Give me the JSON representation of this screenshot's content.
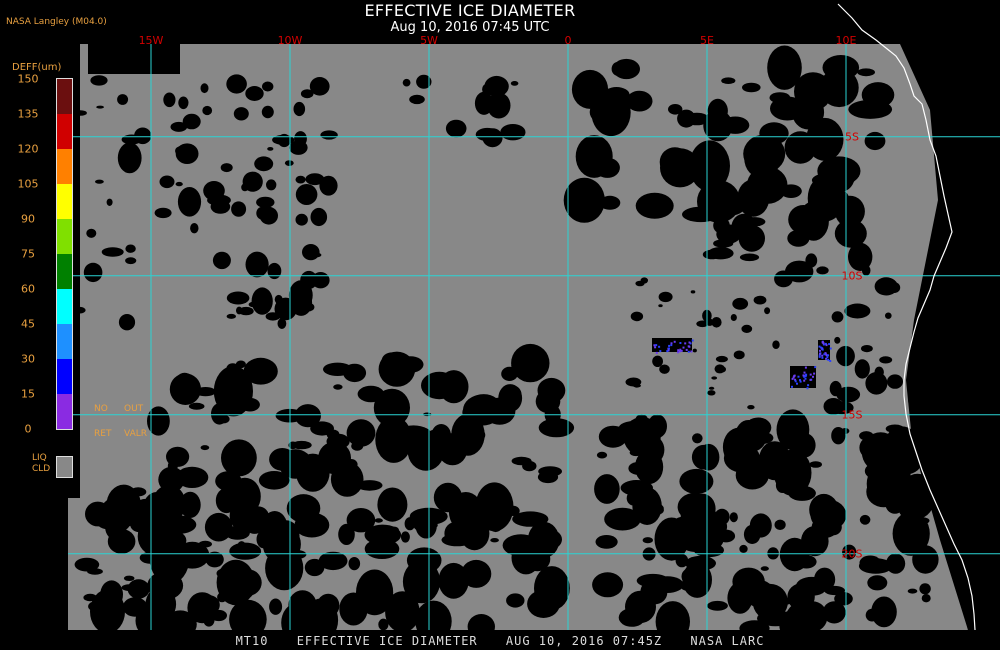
{
  "header": {
    "title": "EFFECTIVE ICE DIAMETER",
    "datetime": "Aug 10, 2016 07:45 UTC",
    "credit": "NASA Langley (M04.0)"
  },
  "lon_labels": [
    {
      "label": "15W",
      "lon": -15
    },
    {
      "label": "10W",
      "lon": -10
    },
    {
      "label": "5W",
      "lon": -5
    },
    {
      "label": "0",
      "lon": 0
    },
    {
      "label": "5E",
      "lon": 5
    },
    {
      "label": "10E",
      "lon": 10
    }
  ],
  "lat_labels": [
    {
      "label": "5S",
      "lat": -5
    },
    {
      "label": "10S",
      "lat": -10
    },
    {
      "label": "15S",
      "lat": -15
    },
    {
      "label": "20S",
      "lat": -20
    }
  ],
  "colors": {
    "grid": "#2ad4d4",
    "labels": "#d40000",
    "cloud": "#888888",
    "background": "#000000",
    "coast": "#ffffff"
  },
  "legend": {
    "title": "DEFF(um)",
    "ticks": [
      "150",
      "135",
      "120",
      "105",
      "90",
      "75",
      "60",
      "45",
      "30",
      "15",
      "0"
    ],
    "colors": [
      "#6b0f0f",
      "#d00000",
      "#ff8000",
      "#ffff00",
      "#80e000",
      "#008000",
      "#00ffff",
      "#1e90ff",
      "#0000ff",
      "#8a2be2"
    ],
    "no_ret": [
      "NO",
      "RET"
    ],
    "out_valr": [
      "OUT",
      "VALR"
    ],
    "liq_cld": [
      "LIQ",
      "CLD"
    ]
  },
  "footer": {
    "product": "MT10",
    "field": "EFFECTIVE ICE DIAMETER",
    "date": "AUG 10, 2016 07:45Z",
    "source": "NASA LARC"
  }
}
